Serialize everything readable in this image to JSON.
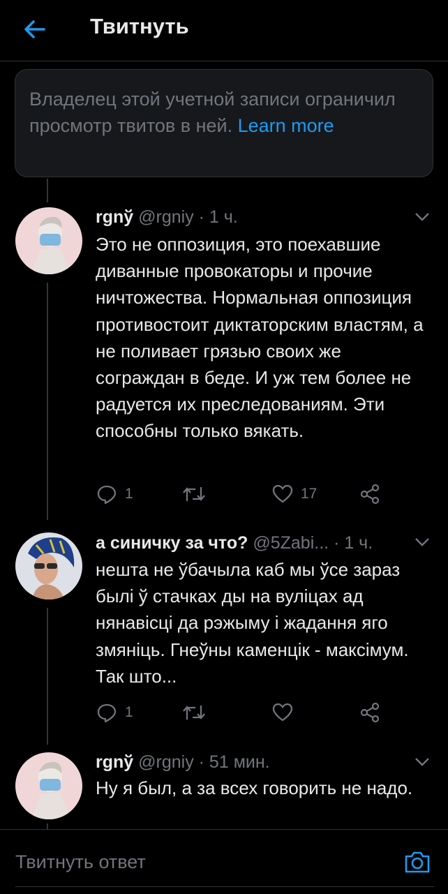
{
  "header": {
    "title": "Твитнуть",
    "back_icon": "arrow-left-icon"
  },
  "notice": {
    "text": "Владелец этой учетной записи ограничил просмотр твитов в ней. ",
    "link": "Learn more"
  },
  "tweets": [
    {
      "name": "rgnў",
      "handle": "@rgniy",
      "time": " · 1 ч.",
      "text": "Это не оппозиция, это поехавшие диванные провокаторы и прочие ничтожества. Нормальная оппозиция противостоит диктаторским властям, а не поливает грязью своих же сограждан в беде. И уж тем более не радуется их преследованиям. Эти способны только вякать.",
      "replies": "1",
      "retweets": "",
      "likes": "17"
    },
    {
      "name": "а синичку за что?",
      "handle": "@5Zabi...",
      "time": " · 1 ч.",
      "text": "нешта не ўбачыла каб мы ўсе зараз былі ў стачках ды на вуліцах ад нянавісці да рэжыму і жадання яго змяніць. Гнеўны каменцік - максімум. Так што...",
      "replies": "1",
      "retweets": "",
      "likes": ""
    },
    {
      "name": "rgnў",
      "handle": "@rgniy",
      "time": " · 51 мин.",
      "text": "Ну я был, а за всех говорить не надо."
    }
  ],
  "reply_bar": {
    "placeholder": "Твитнуть ответ",
    "camera_icon": "camera-icon"
  },
  "colors": {
    "accent": "#1d9bf0",
    "background": "#000000",
    "secondary_text": "#71767b"
  }
}
